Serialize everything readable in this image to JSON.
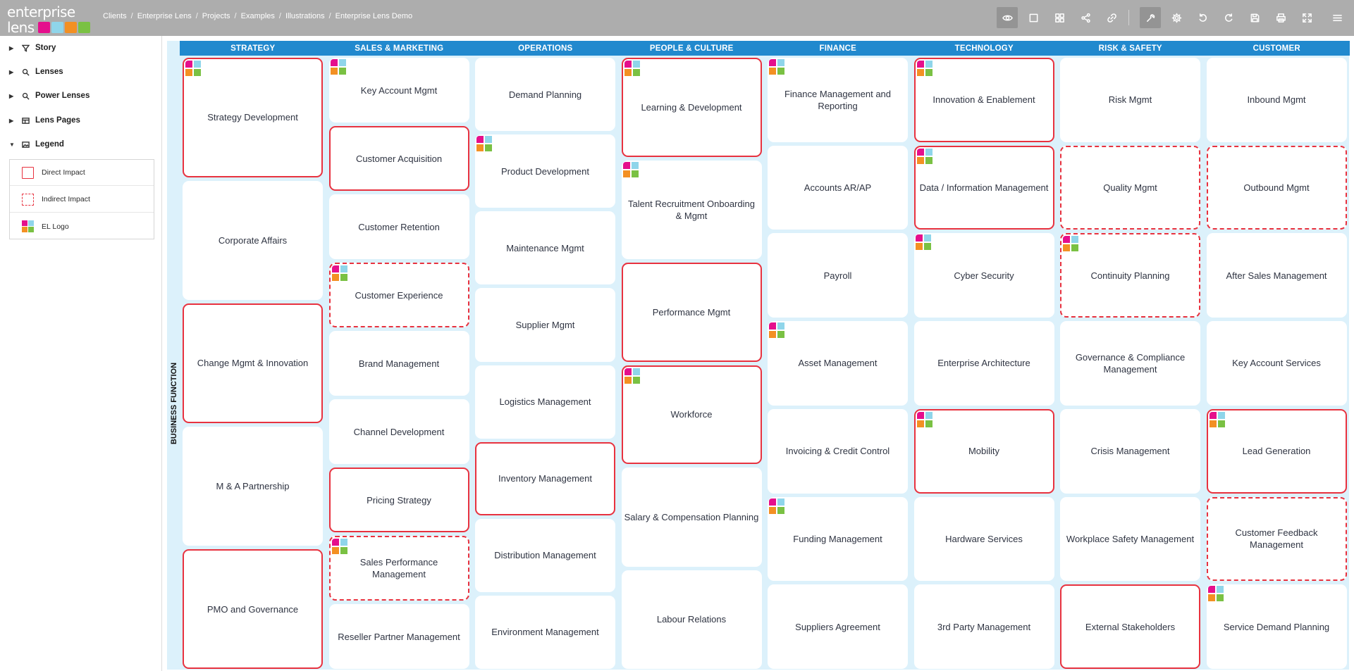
{
  "brand": {
    "name": "enterprise lens",
    "square_colors": [
      "#e50f8c",
      "#8fd5ea",
      "#f39023",
      "#7ac143"
    ]
  },
  "breadcrumb": [
    "Clients",
    "Enterprise Lens",
    "Projects",
    "Examples",
    "Illustrations",
    "Enterprise Lens Demo"
  ],
  "toolbar": {
    "icons": [
      "eye-icon",
      "square-icon",
      "grid-icon",
      "share-icon",
      "link-icon",
      "wrench-icon",
      "gear-icon",
      "undo-icon",
      "redo-icon",
      "save-icon",
      "print-icon",
      "fullscreen-icon",
      "menu-icon"
    ],
    "active": [
      "eye-icon",
      "wrench-icon"
    ]
  },
  "sidebar": {
    "items": [
      {
        "label": "Story",
        "icon": "filter-icon",
        "expanded": false
      },
      {
        "label": "Lenses",
        "icon": "search-icon",
        "expanded": false
      },
      {
        "label": "Power Lenses",
        "icon": "search-icon",
        "expanded": false
      },
      {
        "label": "Lens Pages",
        "icon": "pages-icon",
        "expanded": false
      },
      {
        "label": "Legend",
        "icon": "image-icon",
        "expanded": true
      }
    ],
    "legend": [
      {
        "label": "Direct Impact",
        "type": "direct"
      },
      {
        "label": "Indirect Impact",
        "type": "indirect"
      },
      {
        "label": "EL Logo",
        "type": "logo"
      }
    ]
  },
  "colors": {
    "header_blue": "#2189ce",
    "map_bg": "#dcf1fb",
    "impact_red": "#e8323f"
  },
  "map": {
    "row_label": "BUSINESS FUNCTION",
    "columns": [
      {
        "header": "STRATEGY",
        "capabilities": [
          {
            "label": "Strategy Development",
            "impact": "direct",
            "logo": true
          },
          {
            "label": "Corporate Affairs",
            "impact": "none",
            "logo": false
          },
          {
            "label": "Change Mgmt & Innovation",
            "impact": "direct",
            "logo": false
          },
          {
            "label": "M & A Partnership",
            "impact": "none",
            "logo": false
          },
          {
            "label": "PMO and Governance",
            "impact": "direct",
            "logo": false
          }
        ]
      },
      {
        "header": "SALES & MARKETING",
        "capabilities": [
          {
            "label": "Key Account Mgmt",
            "impact": "none",
            "logo": true
          },
          {
            "label": "Customer Acquisition",
            "impact": "direct",
            "logo": false
          },
          {
            "label": "Customer Retention",
            "impact": "none",
            "logo": false
          },
          {
            "label": "Customer Experience",
            "impact": "indirect",
            "logo": true
          },
          {
            "label": "Brand Management",
            "impact": "none",
            "logo": false
          },
          {
            "label": "Channel Development",
            "impact": "none",
            "logo": false
          },
          {
            "label": "Pricing Strategy",
            "impact": "direct",
            "logo": false
          },
          {
            "label": "Sales Performance Management",
            "impact": "indirect",
            "logo": true
          },
          {
            "label": "Reseller Partner Management",
            "impact": "none",
            "logo": false
          }
        ]
      },
      {
        "header": "OPERATIONS",
        "capabilities": [
          {
            "label": "Demand Planning",
            "impact": "none",
            "logo": false
          },
          {
            "label": "Product Development",
            "impact": "none",
            "logo": true
          },
          {
            "label": "Maintenance Mgmt",
            "impact": "none",
            "logo": false
          },
          {
            "label": "Supplier Mgmt",
            "impact": "none",
            "logo": false
          },
          {
            "label": "Logistics Management",
            "impact": "none",
            "logo": false
          },
          {
            "label": "Inventory Management",
            "impact": "direct",
            "logo": false
          },
          {
            "label": "Distribution Management",
            "impact": "none",
            "logo": false
          },
          {
            "label": "Environment Management",
            "impact": "none",
            "logo": false
          }
        ]
      },
      {
        "header": "PEOPLE & CULTURE",
        "capabilities": [
          {
            "label": "Learning & Development",
            "impact": "direct",
            "logo": true
          },
          {
            "label": "Talent Recruitment Onboarding & Mgmt",
            "impact": "none",
            "logo": true
          },
          {
            "label": "Performance Mgmt",
            "impact": "direct",
            "logo": false
          },
          {
            "label": "Workforce",
            "impact": "direct",
            "logo": true
          },
          {
            "label": "Salary & Compensation Planning",
            "impact": "none",
            "logo": false
          },
          {
            "label": "Labour Relations",
            "impact": "none",
            "logo": false
          }
        ]
      },
      {
        "header": "FINANCE",
        "capabilities": [
          {
            "label": "Finance Management and Reporting",
            "impact": "none",
            "logo": true
          },
          {
            "label": "Accounts AR/AP",
            "impact": "none",
            "logo": false
          },
          {
            "label": "Payroll",
            "impact": "none",
            "logo": false
          },
          {
            "label": "Asset Management",
            "impact": "none",
            "logo": true
          },
          {
            "label": "Invoicing & Credit Control",
            "impact": "none",
            "logo": false
          },
          {
            "label": "Funding Management",
            "impact": "none",
            "logo": true
          },
          {
            "label": "Suppliers Agreement",
            "impact": "none",
            "logo": false
          }
        ]
      },
      {
        "header": "TECHNOLOGY",
        "capabilities": [
          {
            "label": "Innovation & Enablement",
            "impact": "direct",
            "logo": true
          },
          {
            "label": "Data / Information Management",
            "impact": "direct",
            "logo": true
          },
          {
            "label": "Cyber Security",
            "impact": "none",
            "logo": true
          },
          {
            "label": "Enterprise Architecture",
            "impact": "none",
            "logo": false
          },
          {
            "label": "Mobility",
            "impact": "direct",
            "logo": true
          },
          {
            "label": "Hardware Services",
            "impact": "none",
            "logo": false
          },
          {
            "label": "3rd Party Management",
            "impact": "none",
            "logo": false
          }
        ]
      },
      {
        "header": "RISK & SAFETY",
        "capabilities": [
          {
            "label": "Risk Mgmt",
            "impact": "none",
            "logo": false
          },
          {
            "label": "Quality Mgmt",
            "impact": "indirect",
            "logo": false
          },
          {
            "label": "Continuity Planning",
            "impact": "indirect",
            "logo": true
          },
          {
            "label": "Governance & Compliance Management",
            "impact": "none",
            "logo": false
          },
          {
            "label": "Crisis Management",
            "impact": "none",
            "logo": false
          },
          {
            "label": "Workplace Safety Management",
            "impact": "none",
            "logo": false
          },
          {
            "label": "External Stakeholders",
            "impact": "direct",
            "logo": false
          }
        ]
      },
      {
        "header": "CUSTOMER",
        "capabilities": [
          {
            "label": "Inbound Mgmt",
            "impact": "none",
            "logo": false
          },
          {
            "label": "Outbound Mgmt",
            "impact": "indirect",
            "logo": false
          },
          {
            "label": "After Sales Management",
            "impact": "none",
            "logo": false
          },
          {
            "label": "Key Account Services",
            "impact": "none",
            "logo": false
          },
          {
            "label": "Lead Generation",
            "impact": "direct",
            "logo": true
          },
          {
            "label": "Customer Feedback Management",
            "impact": "indirect",
            "logo": false
          },
          {
            "label": "Service Demand Planning",
            "impact": "none",
            "logo": true
          }
        ]
      }
    ]
  }
}
